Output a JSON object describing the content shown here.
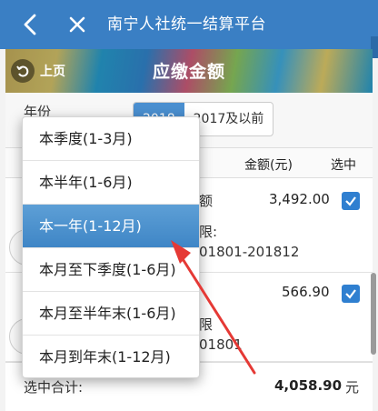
{
  "appbar": {
    "title": "南宁人社统一结算平台"
  },
  "banner": {
    "prev_label": "上页",
    "title": "应缴金额"
  },
  "year": {
    "label": "年份",
    "options": [
      "2018",
      "2017及以前"
    ],
    "selected": "2018"
  },
  "table": {
    "col_amount": "金额(元)",
    "col_select": "选中"
  },
  "rows": [
    {
      "label_fragment": "额",
      "amount": "3,492.00",
      "period_label": "限:",
      "period_value": "01801-201812",
      "checked": true
    },
    {
      "amount": "566.90",
      "period_label": "限",
      "period_value": "01801",
      "checked": true
    }
  ],
  "footer": {
    "label": "选中合计:",
    "total": "4,058.90",
    "unit": "元"
  },
  "dropdown": {
    "items": [
      "本季度(1-3月)",
      "本半年(1-6月)",
      "本一年(1-12月)",
      "本月至下季度(1-6月)",
      "本月至半年末(1-6月)",
      "本月到年末(1-12月)"
    ],
    "selected": "本一年(1-12月)"
  },
  "colors": {
    "appbar": "#3a7fc4",
    "accent": "#4a8fd0",
    "arrow": "#e53935"
  }
}
